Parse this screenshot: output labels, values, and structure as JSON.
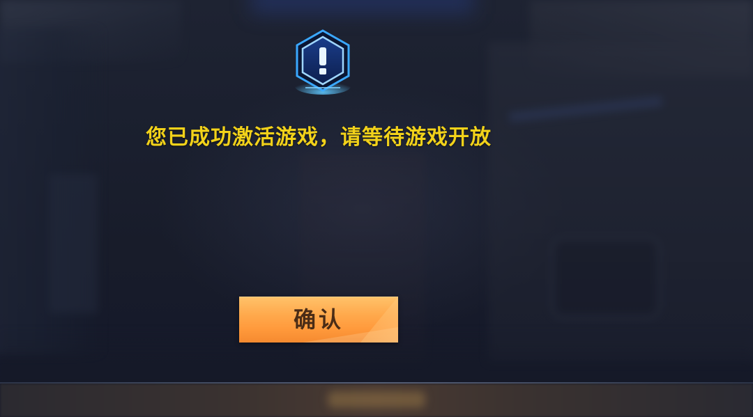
{
  "dialog": {
    "icon": "exclamation-hexagon-icon",
    "message": "您已成功激活游戏，请等待游戏开放",
    "confirm_label": "确认"
  },
  "colors": {
    "message_text": "#f2d21a",
    "button_fill": "#ffa94c",
    "button_text": "#4a2c16",
    "icon_accent": "#3aa8ff"
  }
}
